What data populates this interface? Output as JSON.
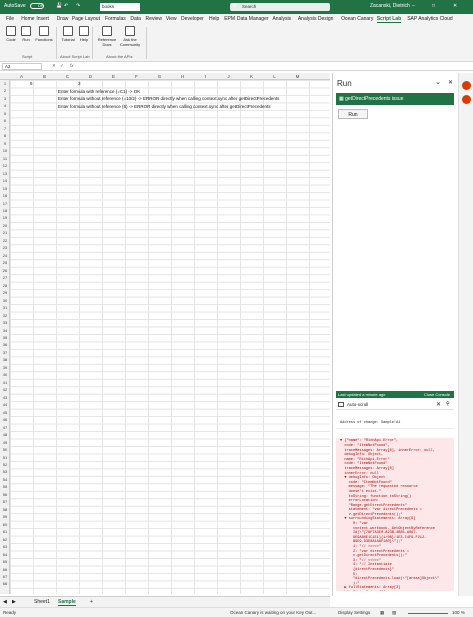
{
  "titlebar": {
    "autosave": "AutoSave",
    "autosave_state": "Off",
    "filename": "books",
    "search": "Search",
    "user": "Zacanski, Dietrich"
  },
  "menu": [
    "File",
    "Home",
    "Insert",
    "Draw",
    "Page Layout",
    "Formulas",
    "Data",
    "Review",
    "View",
    "Developer",
    "Help",
    "EPM",
    "Data Manager",
    "Analysis",
    "Analysis Design",
    "Ocean Canary",
    "Script Lab",
    "SAP Analytics Cloud"
  ],
  "ribbon": {
    "buttons": [
      "Code",
      "Run",
      "Functions",
      "Tutorial",
      "Help",
      "Reference Docs",
      "Ask the Community"
    ],
    "groups": [
      "Script",
      "About Script Lab",
      "About the APIs"
    ]
  },
  "formula_bar": {
    "cell_ref": "A2",
    "fx": "fx"
  },
  "columns": [
    "A",
    "B",
    "C",
    "D",
    "E",
    "F",
    "G",
    "H",
    "I",
    "J",
    "K",
    "L",
    "M"
  ],
  "rows": [
    "1",
    "2",
    "3",
    "4",
    "5",
    "6",
    "7",
    "8",
    "9",
    "10",
    "11",
    "12",
    "13",
    "14",
    "15",
    "16",
    "17",
    "18",
    "19",
    "20",
    "21",
    "22",
    "23",
    "24",
    "25",
    "26",
    "27",
    "28",
    "29",
    "30",
    "31",
    "32",
    "33",
    "34",
    "35",
    "36",
    "37",
    "38",
    "39",
    "40",
    "41",
    "42",
    "43",
    "44",
    "45",
    "46",
    "47",
    "48",
    "49",
    "50",
    "51",
    "52",
    "53",
    "54",
    "55",
    "56",
    "57",
    "58",
    "59",
    "60",
    "61",
    "62",
    "63",
    "64",
    "65",
    "66",
    "67",
    "68"
  ],
  "cells": {
    "a1": "5",
    "c1": "3",
    "c2": "Enter formula with reference (=C1) -> OK",
    "c3": "Enter formula without reference (=10/2) -> ERROR directly when calling context.sync after getDirectPrecedents",
    "c4": "Enter formula without reference (5) -> ERROR directly when calling context.sync after getDirectPrecedents"
  },
  "sheets": {
    "s1": "Sheet1",
    "s2": "Sample",
    "add": "+"
  },
  "status": {
    "ready": "Ready",
    "center": "Ocean Canary is waiting on your Key Out...",
    "display": "Display Settings",
    "zoom": "100 %"
  },
  "pane": {
    "title": "Run",
    "snippet": "getDirectPrecedents issue",
    "run": "Run",
    "updated": "Last updated a minute ago",
    "close_console": "Close Console",
    "autoscroll": "Auto-scroll"
  },
  "console": {
    "plain": "Address of change: Sample!A1",
    "error": "▼ {\"name\": \"RichApi.Error\",\n  code: \"ItemNotFound\",\n  traceMessages: Array[0], innerError: null,\n  debugInfo: Object,\n  name: \"RichApi.Error\"\n  code: \"ItemNotFound\"\n  traceMessages: Array[0]\n  innerError: null\n  ▼ debugInfo: Object\n    code: \"ItemNotFound\"\n    message: \"The requested resource\n    doesn't exist.\"\n    toString: function toString()\n    errorLocation:\n    \"Range.getDirectPrecedents\"\n    statement: \"var directPrecedents =\n    v.getDirectPrecedents();\"\n  ▼ surroundingStatements: Array[6]\n      0: \"var\n      context.workbook._GetObjectByReference\n      Id(\\\"{78F7A3E0-A23B-4B85-A097-\n      8E9AB0E1C1E1}{1/0B}/1E3-C4F9-F212-\n      B9E9-D3D8A1A8F1A0}\\\");\"\n      1: \"// >>>>>\"\n      2: \"var directPrecedents =\n      v.getDirectPrecedents();\"\n      3: \"// <<<<<\"\n      4: \"// Instantiate\n      {directPrecedents}\"\n      5:\n      \"directPrecedents.load(\\\"[areas]Object\\\"\n      ):\"\n  ▶ fullStatements: Array[3]\n  httpStatusCode: 404\n  data: undefined"
  },
  "colors": {
    "excel_green": "#217346",
    "error_bg": "#fde7e9",
    "addin_orange": "#d83b01"
  }
}
